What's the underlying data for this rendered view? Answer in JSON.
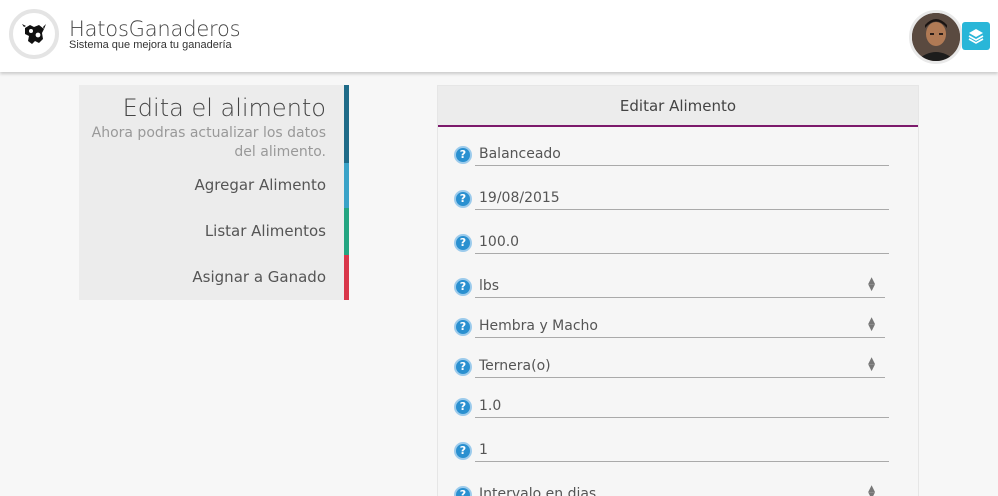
{
  "header": {
    "app_title": "HatosGanaderos",
    "app_subtitle": "Sistema que mejora tu ganadería"
  },
  "menu": {
    "title": "Edita el alimento",
    "description": "Ahora podras actualizar los datos del alimento.",
    "items": [
      {
        "label": "Agregar Alimento"
      },
      {
        "label": "Listar Alimentos"
      },
      {
        "label": "Asignar a Ganado"
      }
    ]
  },
  "form": {
    "title": "Editar Alimento",
    "help_glyph": "?",
    "fields": [
      {
        "value": "Balanceado"
      },
      {
        "value": "19/08/2015"
      },
      {
        "value": "100.0"
      },
      {
        "value": "lbs"
      },
      {
        "value": "Hembra y Macho"
      },
      {
        "value": "Ternera(o)"
      },
      {
        "value": "1.0"
      },
      {
        "value": "1"
      },
      {
        "value": "Intervalo en dias"
      }
    ]
  },
  "colors": {
    "menu_head_bar": "#1f6b88",
    "menu_add_bar": "#3aa3c8",
    "menu_list_bar": "#24a581",
    "menu_assign_bar": "#d9364a",
    "panel_underline": "#7c1a6b",
    "help_icon": "#2a90d0",
    "layers_button": "#29b6d8"
  },
  "icons": [
    "cow-logo-icon",
    "user-avatar",
    "layers-icon",
    "help-icon",
    "select-caret-icon"
  ]
}
